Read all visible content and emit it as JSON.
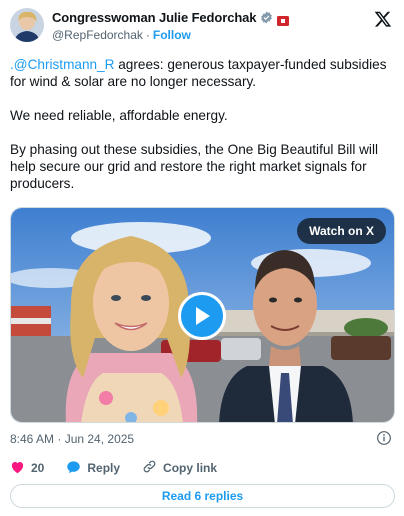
{
  "author": {
    "display_name": "Congresswoman Julie Fedorchak",
    "handle": "@RepFedorchak",
    "follow_label": "Follow",
    "separator": "·"
  },
  "tweet": {
    "mention": ".@Christmann_R",
    "line1_rest": " agrees: generous taxpayer-funded subsidies for wind & solar are no longer necessary.",
    "line2": "We need reliable, affordable energy.",
    "line3": "By phasing out these subsidies, the One Big Beautiful Bill will help secure our grid and restore the right market signals for producers."
  },
  "media": {
    "watch_label": "Watch on X"
  },
  "meta": {
    "timestamp": "8:46 AM · Jun 24, 2025"
  },
  "actions": {
    "like_count": "20",
    "reply_label": "Reply",
    "copy_label": "Copy link"
  },
  "footer": {
    "replies_label": "Read 6 replies"
  },
  "colors": {
    "accent": "#1d9bf0",
    "like": "#f91880",
    "text": "#0f1419",
    "secondary": "#536471",
    "border": "#cfd9de"
  }
}
